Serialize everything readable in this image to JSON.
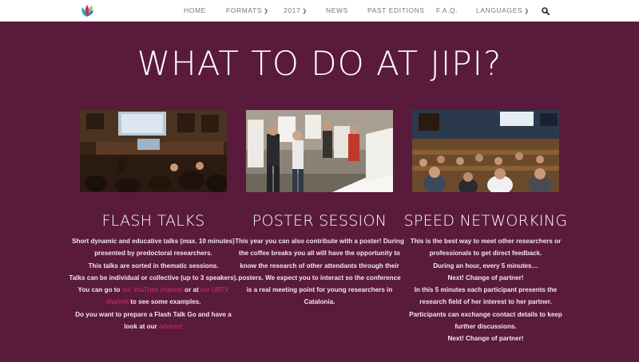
{
  "nav": {
    "items": [
      {
        "label": "HOME",
        "has_dropdown": false
      },
      {
        "label": "FORMATS",
        "has_dropdown": true
      },
      {
        "label": "2017",
        "has_dropdown": true
      },
      {
        "label": "NEWS",
        "has_dropdown": false
      },
      {
        "label": "PAST EDITIONS",
        "has_dropdown": false
      },
      {
        "label": "F.A.Q.",
        "has_dropdown": false
      },
      {
        "label": "LANGUAGES",
        "has_dropdown": true
      }
    ],
    "search_icon": "search-icon",
    "logo_icon": "leaf-logo-icon"
  },
  "page_title": "WHAT TO DO AT JIPI?",
  "columns": [
    {
      "title": "FLASH TALKS",
      "lines": [
        "Short dynamic and educative talks (max. 10 minutes) presented by predoctoral researchers.",
        "This talks are sorted in thematic sessions.",
        "Talks can be individual or collective (up to 3 speakers)."
      ],
      "links_para": {
        "prefix": "You can go to ",
        "link1": "our YouTube channel",
        "middle": " or at ",
        "link2": "our UBTV channel",
        "suffix": " to see some examples."
      },
      "advice_para": {
        "prefix": "Do you want to prepare a Flash Talk Go and have a look at our ",
        "link": "advices!"
      }
    },
    {
      "title": "POSTER SESSION",
      "text": "This year you can also contribute with a poster! During the coffee breaks you all will have the opportunity to know the research of other attendants through their posters. We expect you to interact so the conference is a real meeting point for young researchers in Catalonia."
    },
    {
      "title": "SPEED NETWORKING",
      "lines": [
        "This is the best way to meet other researchers or professionals to get direct feedback.",
        "During an hour, every 5 minutes…",
        "Next! Change of partner!",
        "In this 5 minutes each participant presents the research field of her interest to her partner.",
        "Participants can exchange contact details to keep further discussions.",
        "Next! Change of partner!"
      ]
    }
  ],
  "colors": {
    "background": "#5a1a3c",
    "link": "#e0287c",
    "nav_bg": "#ffffff"
  }
}
